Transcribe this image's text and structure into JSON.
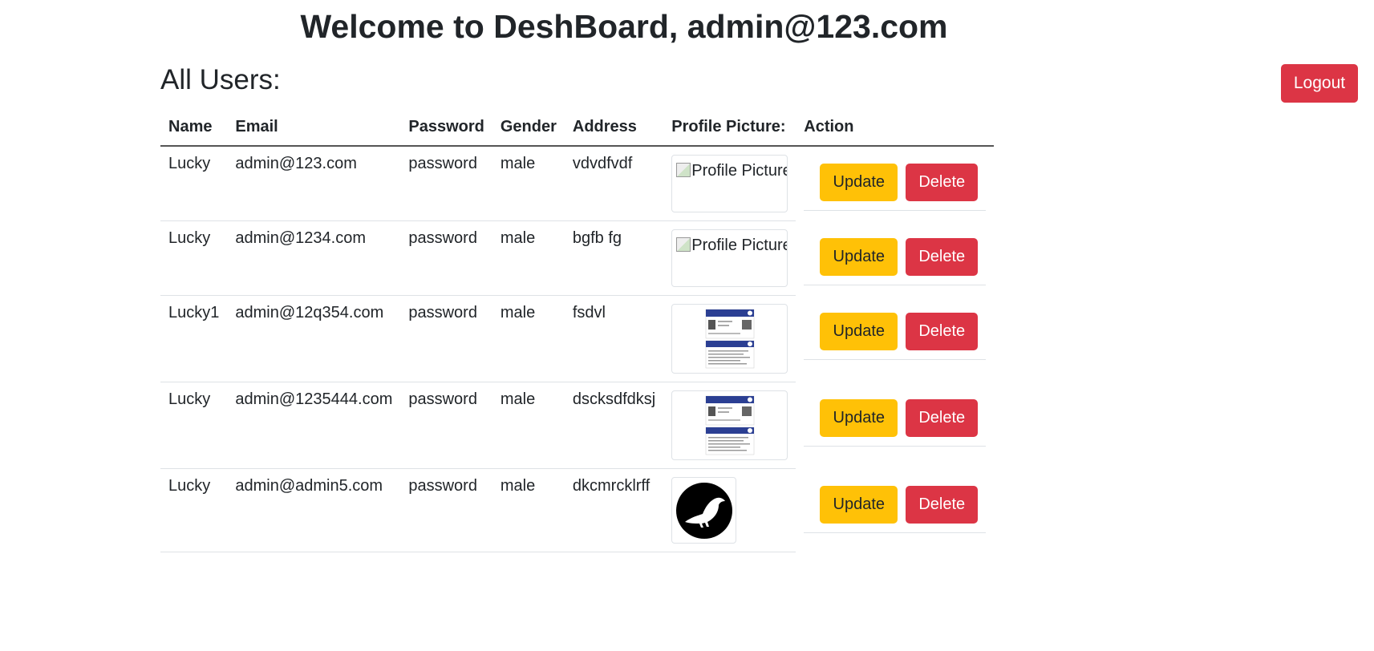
{
  "header": {
    "title": "Welcome to DeshBoard, admin@123.com"
  },
  "section": {
    "title": "All Users:"
  },
  "logout_label": "Logout",
  "table": {
    "columns": [
      "Name",
      "Email",
      "Password",
      "Gender",
      "Address",
      "Profile Picture:",
      "Action"
    ],
    "rows": [
      {
        "name": "Lucky",
        "email": "admin@123.com",
        "password": "password",
        "gender": "male",
        "address": "vdvdfvdf",
        "picture": "broken",
        "alt": "Profile Picture"
      },
      {
        "name": "Lucky",
        "email": "admin@1234.com",
        "password": "password",
        "gender": "male",
        "address": "bgfb fg",
        "picture": "broken",
        "alt": "Profile Picture"
      },
      {
        "name": "Lucky1",
        "email": "admin@12q354.com",
        "password": "password",
        "gender": "male",
        "address": "fsdvl",
        "picture": "id-card-image",
        "alt": ""
      },
      {
        "name": "Lucky",
        "email": "admin@1235444.com",
        "password": "password",
        "gender": "male",
        "address": "dscksdfdksj",
        "picture": "id-card-image",
        "alt": ""
      },
      {
        "name": "Lucky",
        "email": "admin@admin5.com",
        "password": "password",
        "gender": "male",
        "address": "dkcmrcklrff",
        "picture": "bird-logo-image",
        "alt": ""
      }
    ],
    "update_label": "Update",
    "delete_label": "Delete"
  },
  "colors": {
    "danger": "#dc3545",
    "warning": "#ffc107",
    "text": "#212529"
  }
}
